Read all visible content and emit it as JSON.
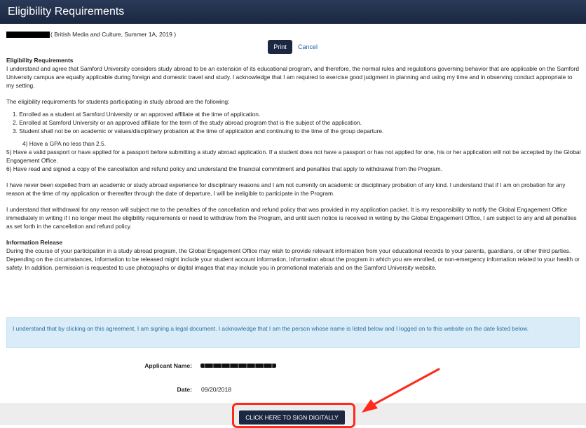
{
  "window": {
    "title": "Eligibility Requirements"
  },
  "program_line": {
    "text": "( British Media and Culture, Summer 1A, 2019 )"
  },
  "actions": {
    "print_label": "Print",
    "cancel_label": "Cancel"
  },
  "agreement": {
    "heading": "Eligibility Requirements",
    "intro": "I understand and agree that Samford University considers study abroad to be an extension of its educational program, and therefore, the normal rules and regulations governing behavior that are applicable on the Samford University campus are equally applicable during foreign and domestic travel and study.  I acknowledge that I am required to exercise good judgment in planning and using my time and in observing conduct appropriate to my setting.",
    "requirements_intro": "The eligibility requirements for students participating in study abroad are the following:",
    "requirements": [
      "1. Enrolled as a student at Samford University or an approved affiliate at the time of application.",
      "2. Enrolled at Samford University or an approved affiliate for the term of the study abroad program that is the subject of the application.",
      "3. Student shall not be on academic or values/disciplinary probation at the time of application and continuing to the time of the group departure."
    ],
    "item4": "4) Have a GPA no less than 2.5.",
    "item5": "5) Have a valid passport or have applied for a passport before submitting a study abroad application. If a student does not have a passport or has not applied for one, his or her application will not be accepted by the Global Engagement Office.",
    "item6": "6) Have read and signed a copy of the cancellation and refund policy and understand the financial commitment and penalties that apply to withdrawal from the Program.",
    "expelled": "I have never been expelled from an academic or study abroad experience for disciplinary reasons and I am not currently on academic or disciplinary probation of any kind.  I understand that if I am on probation for any reason at the time of my application or thereafter through the date of departure, I will be ineligible to participate in the Program.",
    "withdrawal": "I understand that withdrawal for any reason will subject me to the penalties of the cancellation and refund policy that was provided in my application packet.  It is my responsibility to notify the Global Engagement Office immediately in writing if I no longer meet the eligibility requirements or need to withdraw from the Program, and until such notice is received in writing by the Global Engagement Office, I am subject to any and all penalties as set forth in the cancellation and refund policy.",
    "release_heading": "Information Release",
    "release": "During the course of your participation in a study abroad program, the Global Engagement Office may wish to provide relevant information from your educational records to your parents, guardians, or other third parties. Depending on the circumstances, information to be released might include your student account information, information about the program in which you are enrolled, or non-emergency information related to your health or safety. In addition, permission is requested to use photographs or digital images that may include you in promotional materials and on the Samford University website."
  },
  "notice": {
    "text": "I understand that by clicking on this agreement, I am signing a legal document. I acknowledge that I am the person whose name is listed below and I logged on to this website on the date listed below."
  },
  "fields": {
    "applicant_label": "Applicant Name:",
    "date_label": "Date:",
    "date_value": "09/20/2018"
  },
  "sign": {
    "label": "CLICK HERE TO SIGN DIGITALLY"
  },
  "colors": {
    "header": "#1b2740",
    "button": "#1c2741",
    "notice_bg": "#d9ecf7",
    "annotation": "#ff2a1a"
  }
}
